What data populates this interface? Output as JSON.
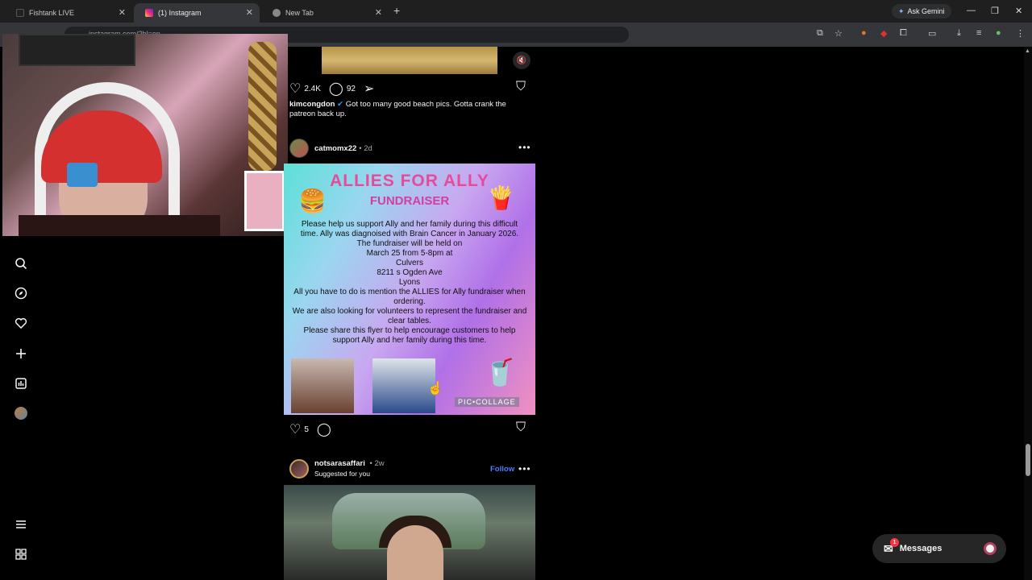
{
  "browser": {
    "tabs": [
      {
        "title": "Fishtank LIVE"
      },
      {
        "title": "(1) Instagram"
      },
      {
        "title": "New Tab"
      }
    ],
    "new_tab_symbol": "+",
    "ask_gemini": "Ask Gemini",
    "url": "instagram.com/?hl=en"
  },
  "feed": {
    "post1": {
      "likes": "2.4K",
      "comments": "92",
      "username": "kimcongdon",
      "caption": "Got too many good beach pics. Gotta crank the patreon back up."
    },
    "post2": {
      "username": "catmomx22",
      "time": "• 2d",
      "flyer": {
        "title": "ALLIES FOR ALLY",
        "subtitle": "FUNDRAISER",
        "lines": [
          "Please help us support Ally and her family during this difficult time. Ally was diagnoised with Brain Cancer in January 2026.",
          "The fundraiser will be held on",
          "March 25 from 5-8pm at",
          "Culvers",
          "8211 s Ogden Ave",
          "Lyons",
          "All you have to do is mention the ALLIES for Ally fundraiser when ordering.",
          "We are also looking for volunteers to represent the fundraiser and clear tables.",
          "Please share this flyer to help encourage customers to help support Ally and her family during this time."
        ],
        "watermark": "PIC•COLLAGE"
      },
      "likes": "5"
    },
    "post3": {
      "username": "notsarasaffari",
      "time": "• 2w",
      "suggested": "Suggested for you",
      "follow": "Follow"
    }
  },
  "messages": {
    "label": "Messages",
    "badge": "1"
  },
  "more_symbol": "•••"
}
